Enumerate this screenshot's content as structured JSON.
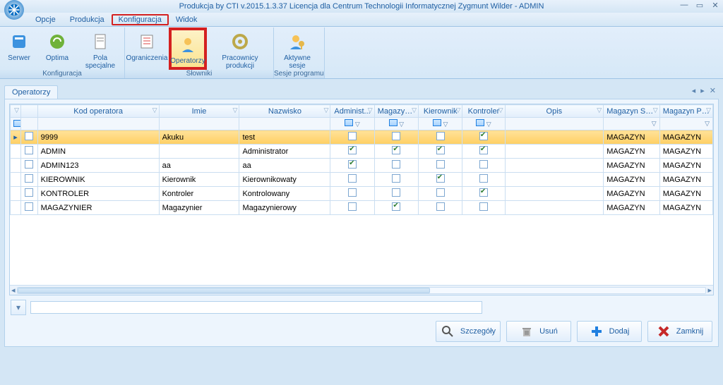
{
  "window": {
    "title": "Produkcja by CTI v.2015.1.3.37 Licencja dla Centrum Technologii Informatycznej Zygmunt Wilder - ADMIN"
  },
  "menu": {
    "opcje": "Opcje",
    "produkcja": "Produkcja",
    "konfiguracja": "Konfiguracja",
    "widok": "Widok"
  },
  "ribbon": {
    "g1": {
      "serwer": "Serwer",
      "optima": "Optima",
      "pola": "Pola specjalne",
      "label": "Konfiguracja"
    },
    "g2": {
      "ogr": "Ograniczenia",
      "oper": "Operatorzy",
      "prac": "Pracownicy produkcji",
      "label": "Słowniki"
    },
    "g3": {
      "sesje": "Aktywne sesje",
      "label": "Sesje programu"
    }
  },
  "tab": "Operatorzy",
  "tab_right_glyphs": "◂  ▸  ✕",
  "headers": {
    "kod": "Kod operatora",
    "imie": "Imie",
    "nazwisko": "Nazwisko",
    "admin": "Administ...",
    "magazyn": "Magazyn...",
    "kierownik": "Kierownik",
    "kontroler": "Kontroler",
    "opis": "Opis",
    "magsur": "Magazyn Suro...",
    "magpro": "Magazyn Pro..."
  },
  "rows": [
    {
      "kod": "9999",
      "imie": "Akuku",
      "nazwisko": "test",
      "admin": false,
      "magazyn": false,
      "kierownik": false,
      "kontroler": true,
      "opis": "",
      "magsur": "MAGAZYN",
      "magpro": "MAGAZYN",
      "selected": true
    },
    {
      "kod": "ADMIN",
      "imie": "",
      "nazwisko": "Administrator",
      "admin": true,
      "magazyn": true,
      "kierownik": true,
      "kontroler": true,
      "opis": "",
      "magsur": "MAGAZYN",
      "magpro": "MAGAZYN"
    },
    {
      "kod": "ADMIN123",
      "imie": "aa",
      "nazwisko": "aa",
      "admin": true,
      "magazyn": false,
      "kierownik": false,
      "kontroler": false,
      "opis": "",
      "magsur": "MAGAZYN",
      "magpro": "MAGAZYN"
    },
    {
      "kod": "KIEROWNIK",
      "imie": "Kierownik",
      "nazwisko": "Kierownikowaty",
      "admin": false,
      "magazyn": false,
      "kierownik": true,
      "kontroler": false,
      "opis": "",
      "magsur": "MAGAZYN",
      "magpro": "MAGAZYN"
    },
    {
      "kod": "KONTROLER",
      "imie": "Kontroler",
      "nazwisko": "Kontrolowany",
      "admin": false,
      "magazyn": false,
      "kierownik": false,
      "kontroler": true,
      "opis": "",
      "magsur": "MAGAZYN",
      "magpro": "MAGAZYN"
    },
    {
      "kod": "MAGAZYNIER",
      "imie": "Magazynier",
      "nazwisko": "Magazynierowy",
      "admin": false,
      "magazyn": true,
      "kierownik": false,
      "kontroler": false,
      "opis": "",
      "magsur": "MAGAZYN",
      "magpro": "MAGAZYN"
    }
  ],
  "buttons": {
    "szczegoly": "Szczegóły",
    "usun": "Usuń",
    "dodaj": "Dodaj",
    "zamknij": "Zamknij"
  }
}
